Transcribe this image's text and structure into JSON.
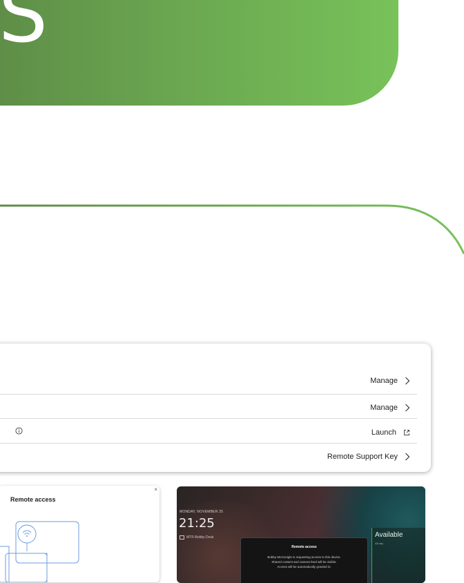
{
  "hero": {
    "letter": "S",
    "colors": {
      "start": "#5e8c47",
      "end": "#78c25a"
    }
  },
  "settings_card": {
    "rows": [
      {
        "action_label": "Manage",
        "action_icon": "chevron-right-icon"
      },
      {
        "action_label": "Manage",
        "action_icon": "chevron-right-icon"
      },
      {
        "leading_icon": "info-icon",
        "action_label": "Launch",
        "action_icon": "external-link-icon"
      },
      {
        "action_label": "Remote Support Key",
        "action_icon": "chevron-right-icon"
      }
    ]
  },
  "remote_access_panel": {
    "title": "Remote access",
    "close_glyph": "×"
  },
  "device_preview": {
    "date": "MONDAY, NOVEMBER 25",
    "time": "21:25",
    "room_name": "MTR-Bobby Desk",
    "status": "Available",
    "status_sub": "All day",
    "status_color": "#3aa660",
    "dialog": {
      "title": "Remote access",
      "line1": "Bobby McGonigle is requesting access to this device.",
      "line2": "Shared content and camera feed will be visible.",
      "line3": "Access will be automatically granted in:"
    }
  }
}
